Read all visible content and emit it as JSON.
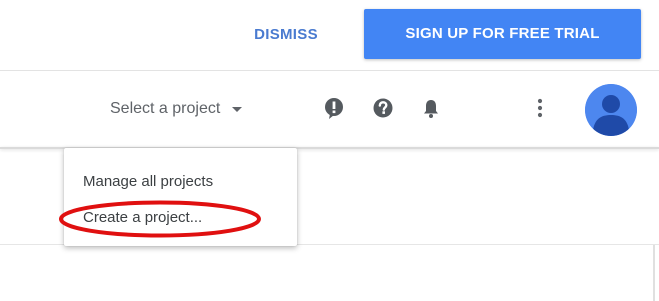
{
  "banner": {
    "dismiss_label": "DISMISS",
    "trial_label": "SIGN UP FOR FREE TRIAL"
  },
  "toolbar": {
    "project_picker_label": "Select a project",
    "icons": [
      "feedback-icon",
      "help-icon",
      "notifications-icon",
      "more-vert-icon"
    ],
    "avatar_icon": "account-avatar"
  },
  "menu": {
    "items": [
      {
        "label": "Manage all projects"
      },
      {
        "label": "Create a project..."
      }
    ]
  },
  "annotation": {
    "highlight_color": "#e01010"
  },
  "colors": {
    "primary": "#4285f4",
    "link": "#4a7bd0",
    "text": "#3c4043",
    "icon": "#5f6368"
  }
}
